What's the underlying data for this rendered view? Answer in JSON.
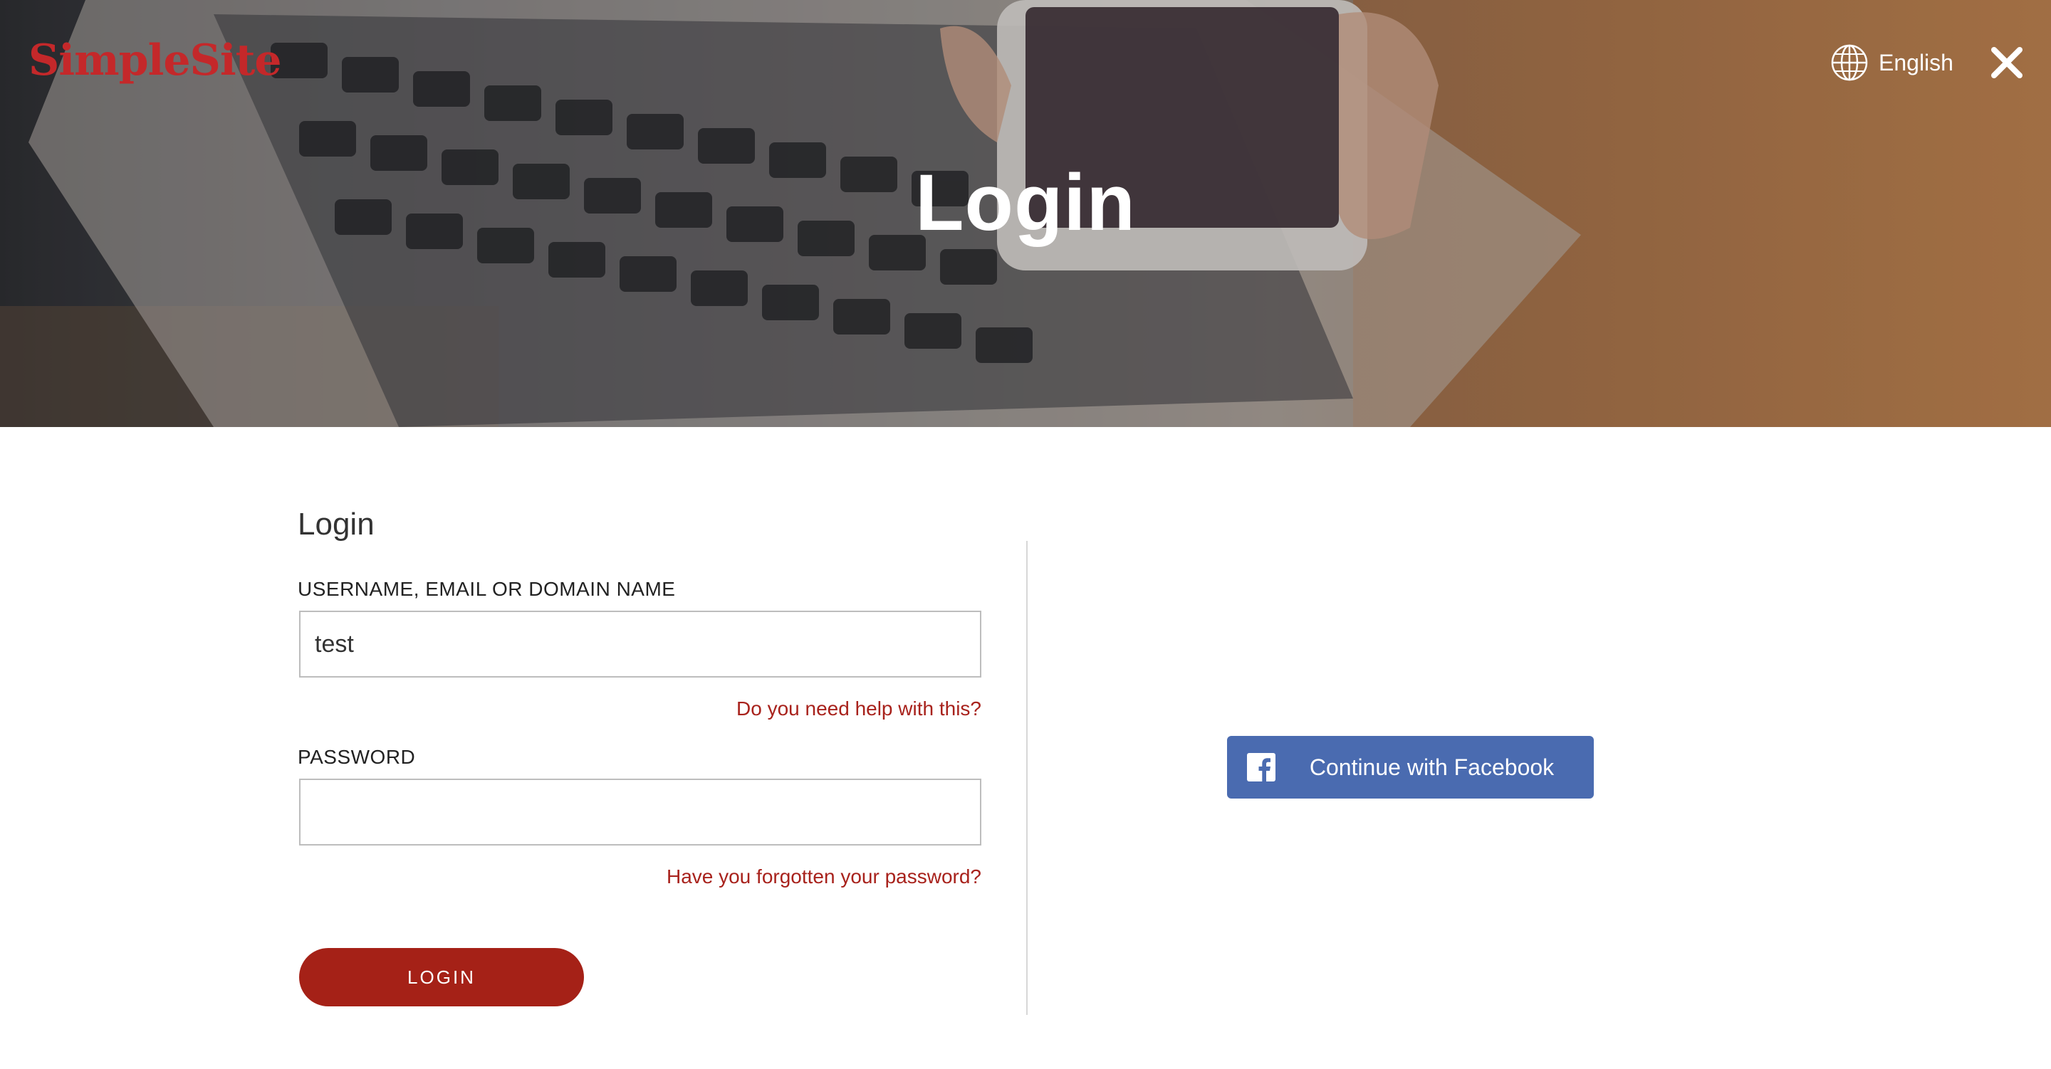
{
  "header": {
    "logo_text": "SimpleSite",
    "language_label": "English",
    "page_title": "Login"
  },
  "form": {
    "heading": "Login",
    "username": {
      "label": "USERNAME, EMAIL OR DOMAIN NAME",
      "value": "test",
      "help_link": "Do you need help with this?"
    },
    "password": {
      "label": "PASSWORD",
      "value": "",
      "help_link": "Have you forgotten your password?"
    },
    "submit_label": "LOGIN"
  },
  "social": {
    "facebook_label": "Continue with Facebook"
  },
  "icons": {
    "language": "globe-icon",
    "close": "close-icon",
    "facebook": "facebook-icon"
  },
  "colors": {
    "brand_red": "#c4282a",
    "link_red": "#a8221c",
    "button_red": "#a52117",
    "facebook_blue": "#4a6bb0"
  }
}
